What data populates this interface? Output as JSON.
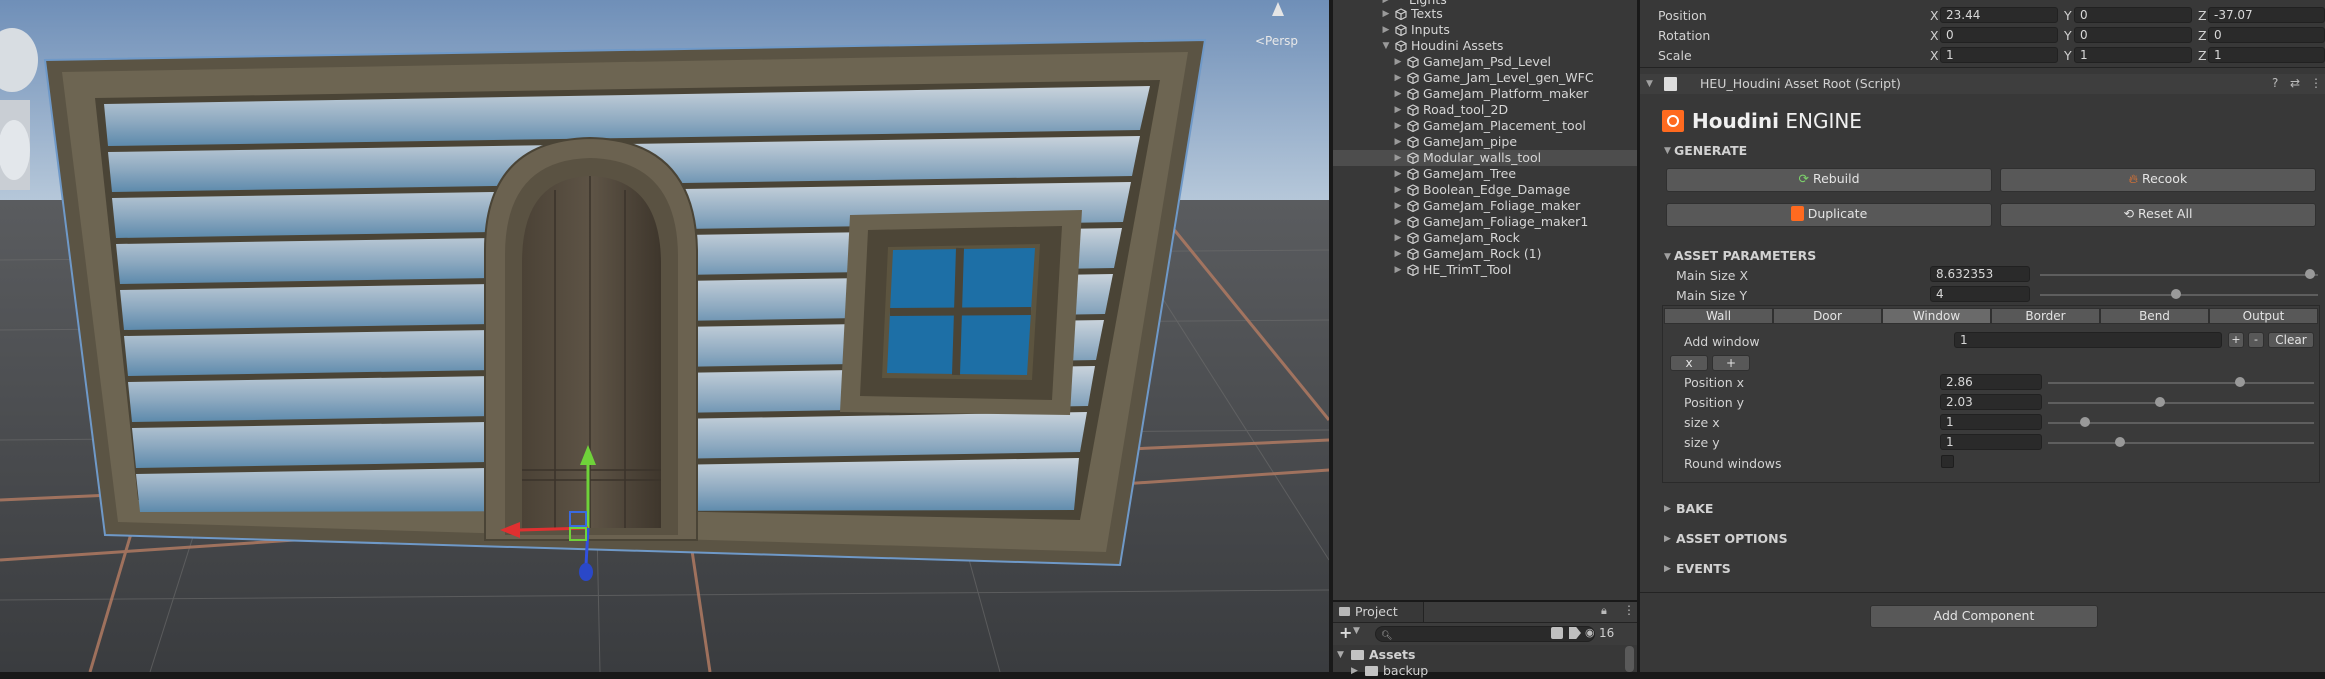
{
  "scene": {
    "persp_label": "<Persp"
  },
  "hierarchy": {
    "partial_top": "Lights",
    "items": [
      {
        "label": "Texts",
        "depth": 1,
        "arrow": "▶",
        "selected": false
      },
      {
        "label": "Inputs",
        "depth": 1,
        "arrow": "▶",
        "selected": false
      },
      {
        "label": "Houdini Assets",
        "depth": 1,
        "arrow": "▼",
        "selected": false
      },
      {
        "label": "GameJam_Psd_Level",
        "depth": 2,
        "arrow": "▶",
        "selected": false
      },
      {
        "label": "Game_Jam_Level_gen_WFC",
        "depth": 2,
        "arrow": "▶",
        "selected": false
      },
      {
        "label": "GameJam_Platform_maker",
        "depth": 2,
        "arrow": "▶",
        "selected": false
      },
      {
        "label": "Road_tool_2D",
        "depth": 2,
        "arrow": "▶",
        "selected": false
      },
      {
        "label": "GameJam_Placement_tool",
        "depth": 2,
        "arrow": "▶",
        "selected": false
      },
      {
        "label": "GameJam_pipe",
        "depth": 2,
        "arrow": "▶",
        "selected": false
      },
      {
        "label": "Modular_walls_tool",
        "depth": 2,
        "arrow": "▶",
        "selected": true
      },
      {
        "label": "GameJam_Tree",
        "depth": 2,
        "arrow": "▶",
        "selected": false
      },
      {
        "label": "Boolean_Edge_Damage",
        "depth": 2,
        "arrow": "▶",
        "selected": false
      },
      {
        "label": "GameJam_Foliage_maker",
        "depth": 2,
        "arrow": "▶",
        "selected": false
      },
      {
        "label": "GameJam_Foliage_maker1",
        "depth": 2,
        "arrow": "▶",
        "selected": false
      },
      {
        "label": "GameJam_Rock",
        "depth": 2,
        "arrow": "▶",
        "selected": false
      },
      {
        "label": "GameJam_Rock (1)",
        "depth": 2,
        "arrow": "▶",
        "selected": false
      },
      {
        "label": "HE_TrimT_Tool",
        "depth": 2,
        "arrow": "▶",
        "selected": false
      }
    ]
  },
  "project": {
    "tab_label": "Project",
    "add_label": "+",
    "search_placeholder": "",
    "hidden_count": "16",
    "assets_label": "Assets",
    "backup_label": "backup"
  },
  "transform": {
    "position_label": "Position",
    "rotation_label": "Rotation",
    "scale_label": "Scale",
    "x_label": "X",
    "y_label": "Y",
    "z_label": "Z",
    "position": {
      "x": "23.44",
      "y": "0",
      "z": "-37.07"
    },
    "rotation": {
      "x": "0",
      "y": "0",
      "z": "0"
    },
    "scale": {
      "x": "1",
      "y": "1",
      "z": "1"
    }
  },
  "component": {
    "title": "HEU_Houdini Asset Root (Script)",
    "logo_bold": "Houdini",
    "logo_rest": " ENGINE",
    "generate_label": "GENERATE",
    "rebuild_label": "Rebuild",
    "recook_label": "Recook",
    "duplicate_label": "Duplicate",
    "reset_all_label": "Reset All",
    "asset_params_label": "ASSET PARAMETERS",
    "main_size_x_label": "Main Size X",
    "main_size_x_value": "8.632353",
    "main_size_x_fraction": 0.97,
    "main_size_y_label": "Main Size Y",
    "main_size_y_value": "4",
    "main_size_y_fraction": 0.49,
    "tabs": [
      "Wall",
      "Door",
      "Window",
      "Border",
      "Bend",
      "Output"
    ],
    "active_tab": "Window",
    "add_window_label": "Add window",
    "add_window_value": "1",
    "plus_label": "+",
    "minus_label": "-",
    "clear_label": "Clear",
    "x_button": "x",
    "plus_button": "+",
    "position_x_label": "Position x",
    "position_x_value": "2.86",
    "position_x_fraction": 0.72,
    "position_y_label": "Position y",
    "position_y_value": "2.03",
    "position_y_fraction": 0.42,
    "size_x_label": "size x",
    "size_x_value": "1",
    "size_x_fraction": 0.14,
    "size_y_label": "size y",
    "size_y_value": "1",
    "size_y_fraction": 0.27,
    "round_windows_label": "Round windows",
    "round_windows_checked": false,
    "bake_label": "BAKE",
    "asset_options_label": "ASSET OPTIONS",
    "events_label": "EVENTS"
  },
  "add_component_label": "Add Component",
  "colors": {
    "accent_blue": "#3a72b0",
    "houdini_orange": "#ff6a1f",
    "panel_bg": "#383838",
    "field_bg": "#2a2a2a"
  }
}
